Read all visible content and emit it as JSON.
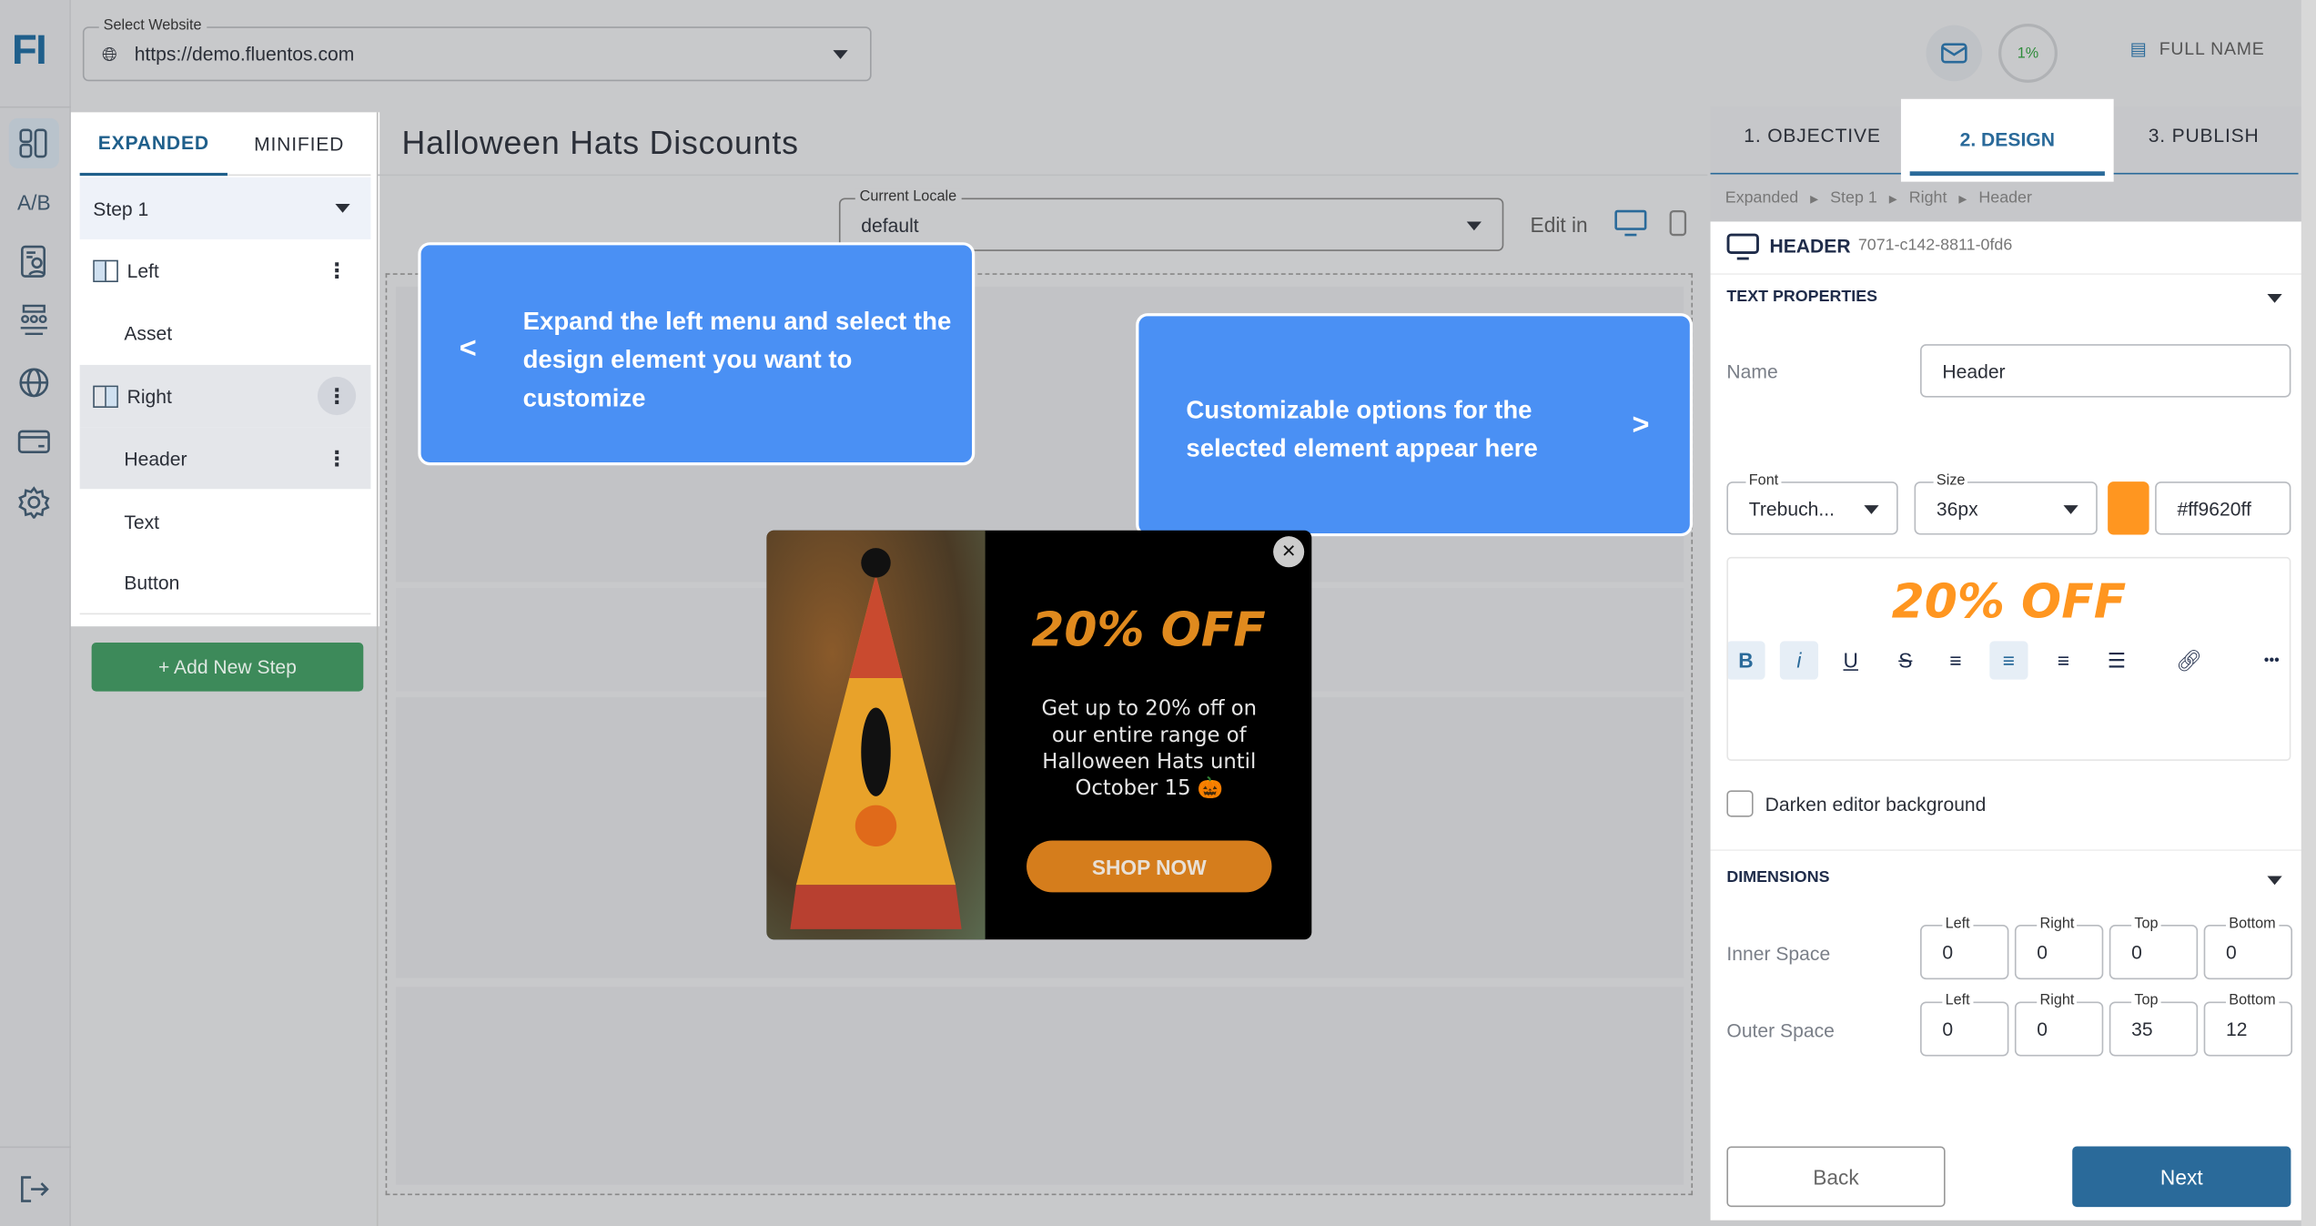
{
  "app": {
    "logo": "FI",
    "rail_icons": [
      "layout-icon",
      "ab-test-icon",
      "contact-report-icon",
      "audience-icon",
      "globe-icon",
      "billing-icon",
      "gear-icon"
    ],
    "rail_ab": "A/B"
  },
  "website": {
    "label": "Select Website",
    "value": "https://demo.fluentos.com"
  },
  "header": {
    "progress": "1%",
    "progress_value": 1,
    "user": "FULL NAME"
  },
  "left_panel": {
    "tabs": [
      "EXPANDED",
      "MINIFIED"
    ],
    "active_tab": "EXPANDED",
    "step": "Step 1",
    "items": [
      {
        "label": "Left",
        "type": "column"
      },
      {
        "label": "Asset",
        "type": "child"
      },
      {
        "label": "Right",
        "type": "column"
      },
      {
        "label": "Header",
        "type": "child"
      },
      {
        "label": "Text",
        "type": "child"
      },
      {
        "label": "Button",
        "type": "child"
      }
    ],
    "add_step": "+ Add New Step"
  },
  "main": {
    "title": "Halloween Hats Discounts",
    "locale_label": "Current Locale",
    "locale_value": "default",
    "edit_in": "Edit in"
  },
  "tips": {
    "left": "Expand the left menu and select the design element you want to customize",
    "left_arrow": "<",
    "right": "Customizable options for the selected element appear here",
    "right_arrow": ">"
  },
  "popup": {
    "headline": "20% OFF",
    "body": "Get up to 20% off on our entire range of Halloween Hats until October 15",
    "emoji": "🎃",
    "cta": "SHOP NOW",
    "close": "×",
    "headline_color": "#e08a1e",
    "cta_color": "#d57d1c"
  },
  "steps": {
    "tabs": [
      "1. OBJECTIVE",
      "2. DESIGN",
      "3. PUBLISH"
    ],
    "active": "2. DESIGN"
  },
  "breadcrumb": [
    "Expanded",
    "Step 1",
    "Right",
    "Header"
  ],
  "element": {
    "type": "HEADER",
    "id": "7071-c142-8811-0fd6"
  },
  "text_props": {
    "title": "TEXT PROPERTIES",
    "name_label": "Name",
    "name_value": "Header",
    "font_label": "Font",
    "font_value": "Trebuch...",
    "size_label": "Size",
    "size_value": "36px",
    "color_value": "#ff9620ff",
    "color": "#ff9620",
    "preview": "20% OFF",
    "darken_label": "Darken editor background",
    "darken_checked": false,
    "toolbar": {
      "bold": "B",
      "italic": "i",
      "underline": "U",
      "strike": "S",
      "more": "•••"
    }
  },
  "dimensions": {
    "title": "DIMENSIONS",
    "cols": [
      "Left",
      "Right",
      "Top",
      "Bottom"
    ],
    "inner_label": "Inner Space",
    "inner": [
      "0",
      "0",
      "0",
      "0"
    ],
    "outer_label": "Outer Space",
    "outer": [
      "0",
      "0",
      "35",
      "12"
    ]
  },
  "footer": {
    "back": "Back",
    "next": "Next"
  }
}
